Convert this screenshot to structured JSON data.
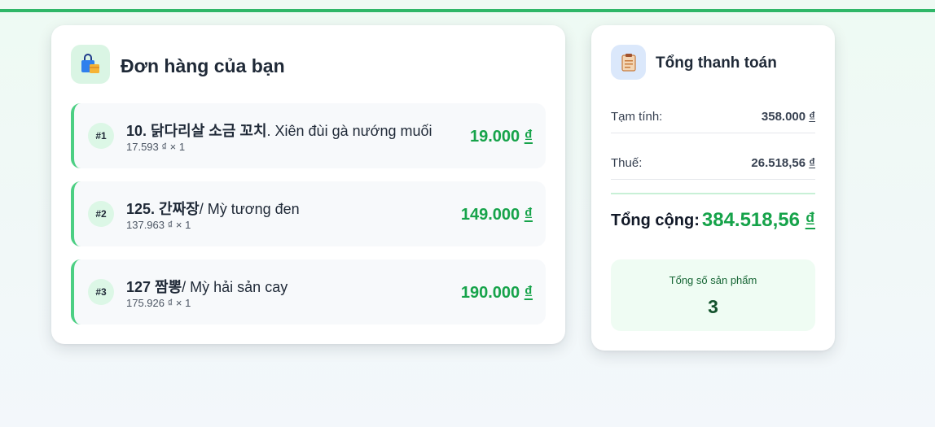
{
  "orders": {
    "title": "Đơn hàng của bạn",
    "items": [
      {
        "badge": "#1",
        "name_ko": "10. 닭다리살 소금 꼬치",
        "name_vi": ". Xiên đùi gà nướng muối",
        "unit_line": "17.593 ₫ × 1",
        "price": "19.000",
        "currency": "₫"
      },
      {
        "badge": "#2",
        "name_ko": "125. 간짜장",
        "name_vi": "/ Mỳ tương đen",
        "unit_line": "137.963 ₫ × 1",
        "price": "149.000",
        "currency": "₫"
      },
      {
        "badge": "#3",
        "name_ko": "127 짬뽕",
        "name_vi": "/ Mỳ hải sản cay",
        "unit_line": "175.926 ₫ × 1",
        "price": "190.000",
        "currency": "₫"
      }
    ]
  },
  "summary": {
    "title": "Tổng thanh toán",
    "subtotal_label": "Tạm tính:",
    "subtotal_value": "358.000",
    "tax_label": "Thuế:",
    "tax_value": "26.518,56",
    "currency": "₫",
    "total_label": "Tổng cộng:",
    "total_value": "384.518,56",
    "count_label": "Tổng số sản phẩm",
    "count_value": "3"
  },
  "colors": {
    "accent_green": "#16a34a",
    "top_bar": "#2fb768",
    "item_border": "#4ccf83"
  },
  "icons": {
    "orders": "shopping-bag-icon",
    "summary": "clipboard-icon"
  }
}
